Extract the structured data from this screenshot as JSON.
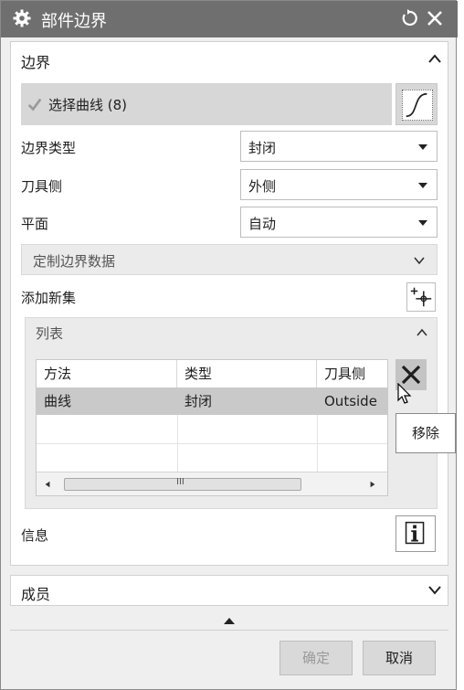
{
  "window": {
    "title": "部件边界"
  },
  "boundary_section": {
    "title": "边界",
    "select_curve_label": "选择曲线 (8)",
    "boundary_type": {
      "label": "边界类型",
      "value": "封闭"
    },
    "tool_side": {
      "label": "刀具侧",
      "value": "外侧"
    },
    "plane": {
      "label": "平面",
      "value": "自动"
    },
    "custom_boundary_data": "定制边界数据",
    "add_new_set": "添加新集",
    "list": {
      "title": "列表",
      "columns": [
        "方法",
        "类型",
        "刀具侧"
      ],
      "rows": [
        [
          "曲线",
          "封闭",
          "Outside"
        ]
      ],
      "scroll_grip": "III"
    },
    "remove_tooltip": "移除",
    "info_label": "信息"
  },
  "members_section": {
    "title": "成员"
  },
  "buttons": {
    "ok": "确定",
    "cancel": "取消"
  },
  "colors": {
    "titlebar": "#6f6f6f",
    "selected_row": "#c9c9c9",
    "check": "#9a9a9a"
  }
}
